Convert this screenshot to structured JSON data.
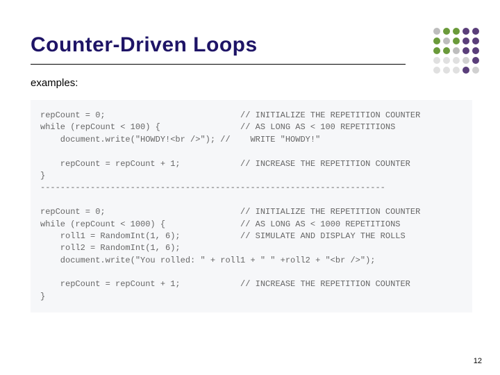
{
  "title": "Counter-Driven Loops",
  "subheading": "examples:",
  "code": "repCount = 0;                           // INITIALIZE THE REPETITION COUNTER\nwhile (repCount < 100) {                // AS LONG AS < 100 REPETITIONS\n    document.write(\"HOWDY!<br />\"); //    WRITE \"HOWDY!\"\n\n    repCount = repCount + 1;            // INCREASE THE REPETITION COUNTER\n}\n---------------------------------------------------------------------\n\nrepCount = 0;                           // INITIALIZE THE REPETITION COUNTER\nwhile (repCount < 1000) {               // AS LONG AS < 1000 REPETITIONS\n    roll1 = RandomInt(1, 6);            // SIMULATE AND DISPLAY THE ROLLS\n    roll2 = RandomInt(1, 6);\n    document.write(\"You rolled: \" + roll1 + \" \" +roll2 + \"<br />\");\n\n    repCount = repCount + 1;            // INCREASE THE REPETITION COUNTER\n}",
  "page_number": "12",
  "deco_colors": [
    "#bdbdbd",
    "#6a9a3a",
    "#6a9a3a",
    "#5a3e7a",
    "#5a3e7a",
    "#6a9a3a",
    "#bdbdbd",
    "#6a9a3a",
    "#5a3e7a",
    "#5a3e7a",
    "#6a9a3a",
    "#6a9a3a",
    "#bdbdbd",
    "#5a3e7a",
    "#5a3e7a",
    "#e0e0e0",
    "#e0e0e0",
    "#e0e0e0",
    "#d0d0d0",
    "#5a3e7a",
    "#e0e0e0",
    "#e0e0e0",
    "#e0e0e0",
    "#5a3e7a",
    "#d0d0d0"
  ]
}
